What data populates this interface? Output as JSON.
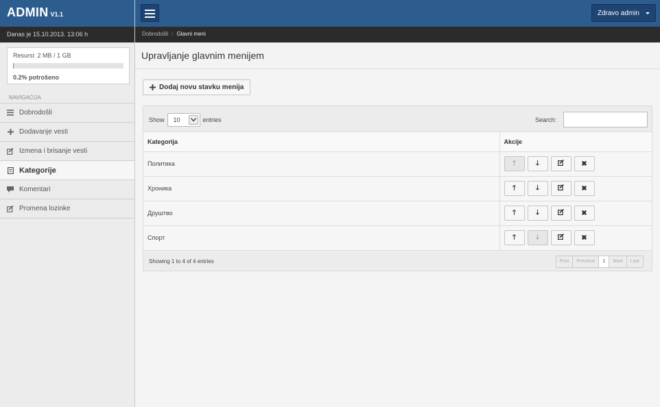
{
  "brand": {
    "name": "ADMIN",
    "version": "V1.1"
  },
  "date_text": "Danas je 15.10.2013. 13:06 h",
  "resources": {
    "label": "Resursi: 2 MB / 1 GB",
    "used_percent": 0.2,
    "used_text": "0.2% potrošeno"
  },
  "nav": {
    "heading": "NAVIGACIJA",
    "items": [
      {
        "label": "Dobrodošli",
        "icon": "list-icon"
      },
      {
        "label": "Dodavanje vesti",
        "icon": "plus-icon"
      },
      {
        "label": "Izmena i brisanje vesti",
        "icon": "edit-icon"
      },
      {
        "label": "Kategorije",
        "icon": "book-icon",
        "active": true
      },
      {
        "label": "Komentari",
        "icon": "comment-icon"
      },
      {
        "label": "Promena lozinke",
        "icon": "edit-icon"
      }
    ]
  },
  "topbar": {
    "user_label": "Zdravo admin"
  },
  "breadcrumb": {
    "home": "Dobrodošli",
    "current": "Glavni meni"
  },
  "page_title": "Upravljanje glavnim menijem",
  "add_button": "Dodaj novu stavku menija",
  "table": {
    "show_label": "Show",
    "entries_label": "entries",
    "page_length": "10",
    "search_label": "Search:",
    "columns": [
      "Kategorija",
      "Akcije"
    ],
    "rows": [
      "Политика",
      "Хроника",
      "Друштво",
      "Спорт"
    ],
    "info": "Showing 1 to 4 of 4 entries",
    "pagination": [
      "First",
      "Previous",
      "1",
      "Next",
      "Last"
    ]
  },
  "colors": {
    "primary": "#2d5c8f",
    "dark_bar": "#2b2b2b"
  }
}
